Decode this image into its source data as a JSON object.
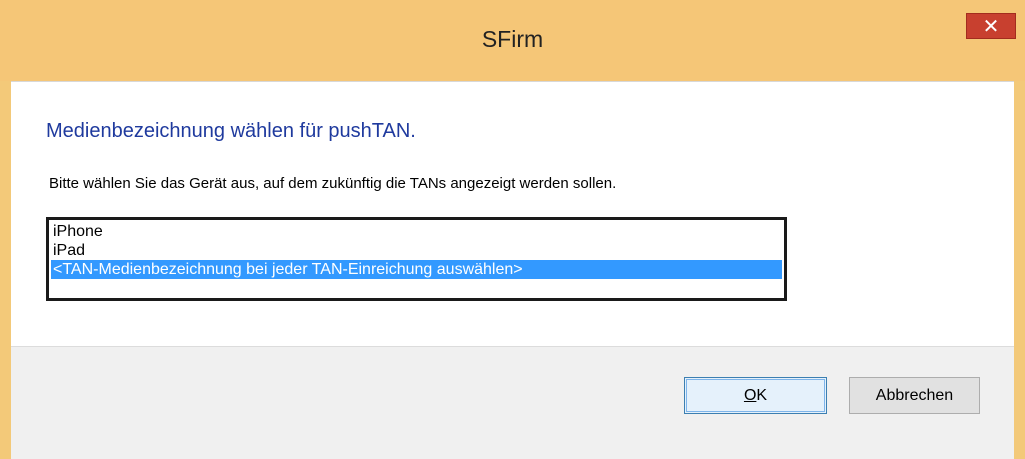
{
  "window": {
    "title": "SFirm",
    "close_glyph": "✕"
  },
  "dialog": {
    "heading": "Medienbezeichnung wählen für pushTAN.",
    "instruction": "Bitte wählen Sie das Gerät aus, auf dem zukünftig die TANs angezeigt werden sollen.",
    "devices": [
      {
        "label": "iPhone",
        "selected": false
      },
      {
        "label": "iPad",
        "selected": false
      },
      {
        "label": "<TAN-Medienbezeichnung bei jeder TAN-Einreichung auswählen>",
        "selected": true
      }
    ]
  },
  "buttons": {
    "ok_label": "OK",
    "cancel_label": "Abbrechen"
  },
  "colors": {
    "titlebar": "#f5c677",
    "close_button": "#c8402f",
    "heading_text": "#1f3a9e",
    "selection": "#3399ff"
  },
  "icons": {
    "close": "close-icon"
  }
}
